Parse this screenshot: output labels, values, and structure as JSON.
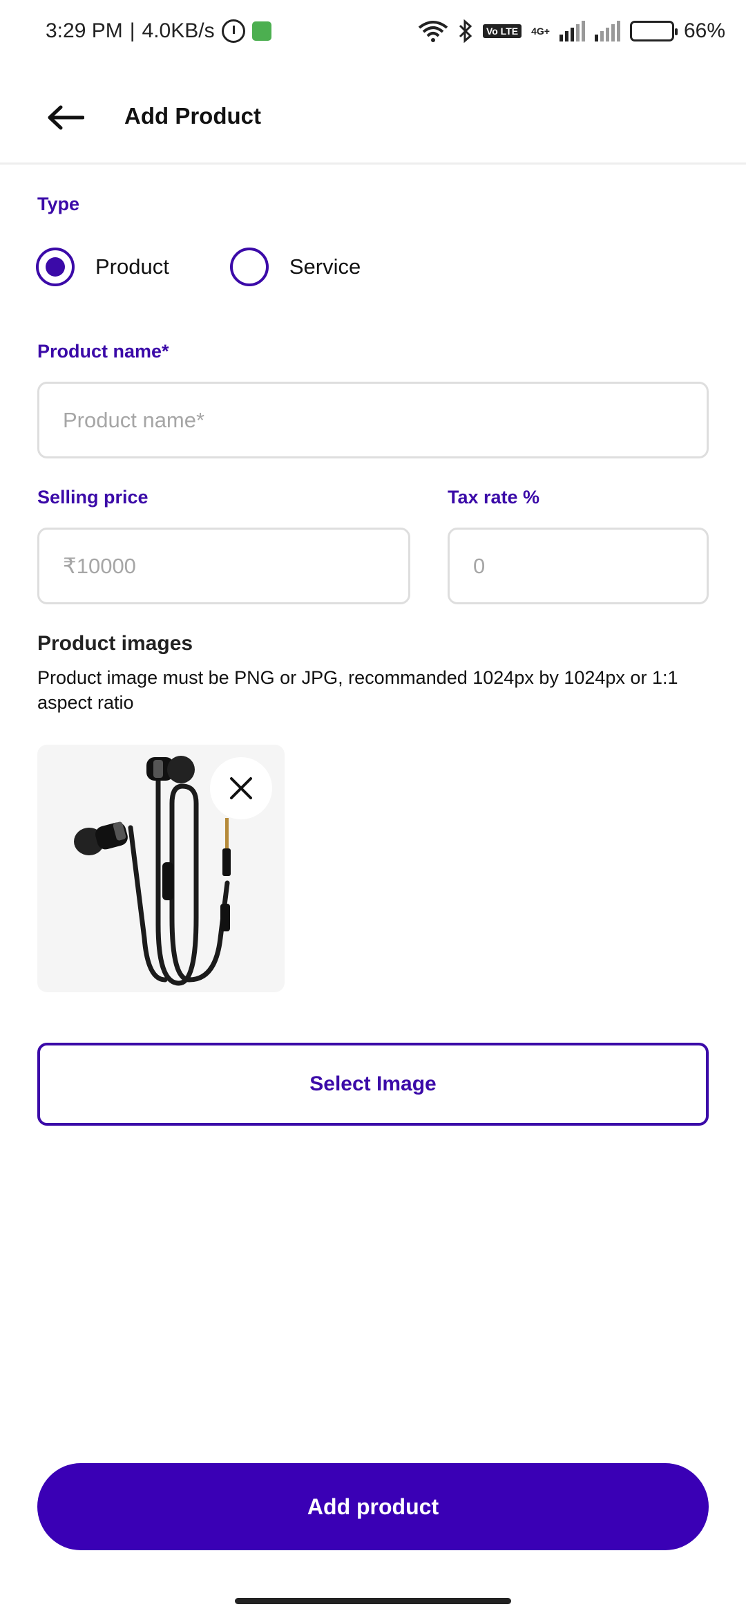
{
  "status_bar": {
    "time": "3:29 PM",
    "separator": "|",
    "speed": "4.0KB/s",
    "volte": "Vo LTE",
    "network": "4G+",
    "battery": "66%"
  },
  "header": {
    "title": "Add Product"
  },
  "form": {
    "type_label": "Type",
    "type_options": [
      "Product",
      "Service"
    ],
    "type_selected": "Product",
    "product_name_label": "Product name*",
    "product_name_placeholder": "Product name*",
    "selling_price_label": "Selling price",
    "selling_price_placeholder": "₹10000",
    "tax_rate_label": "Tax rate %",
    "tax_rate_placeholder": "0",
    "images_title": "Product images",
    "images_help": "Product image must be PNG or JPG, recommanded 1024px by 1024px or 1:1 aspect ratio",
    "images": [
      {
        "alt": "earphones",
        "icon": "earphones-image"
      }
    ]
  },
  "buttons": {
    "select_image": "Select Image",
    "submit": "Add product"
  },
  "colors": {
    "accent": "#3b0aa8",
    "primary_button": "#3a00b5"
  }
}
